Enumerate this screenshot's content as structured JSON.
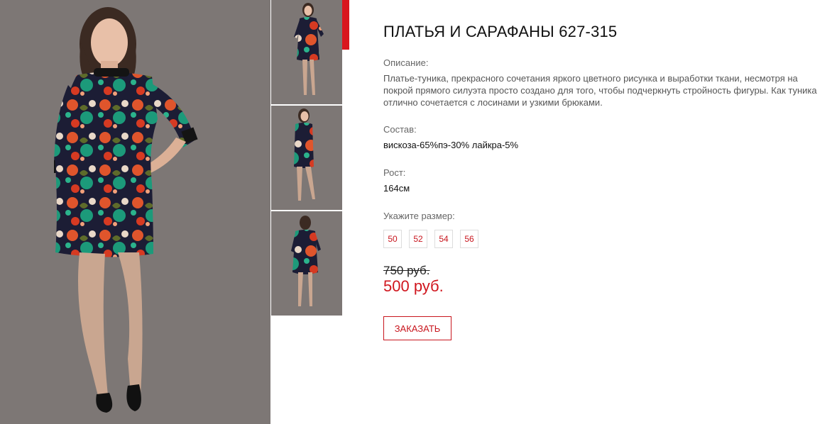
{
  "product": {
    "title": "ПЛАТЬЯ И САРАФАНЫ 627-315",
    "description_label": "Описание:",
    "description": "Платье-туника, прекрасного сочетания яркого цветного рисунка и выработки ткани, несмотря на покрой прямого силуэта просто создано для того, чтобы подчеркнуть стройность фигуры. Как туника отлично сочетается с лосинами и узкими брюками.",
    "composition_label": "Состав:",
    "composition": "вискоза-65%пэ-30% лайкра-5%",
    "height_label": "Рост:",
    "height": "164см",
    "size_label": "Укажите размер:",
    "sizes": [
      "50",
      "52",
      "54",
      "56"
    ],
    "old_price": "750 руб.",
    "new_price": "500 руб.",
    "order_button": "ЗАКАЗАТЬ"
  },
  "colors": {
    "accent": "#d9161e",
    "photo_background": "#7d7775",
    "dress_dark": "#1c1d35",
    "dress_orange": "#e0552c",
    "dress_green": "#1c9a7a"
  }
}
